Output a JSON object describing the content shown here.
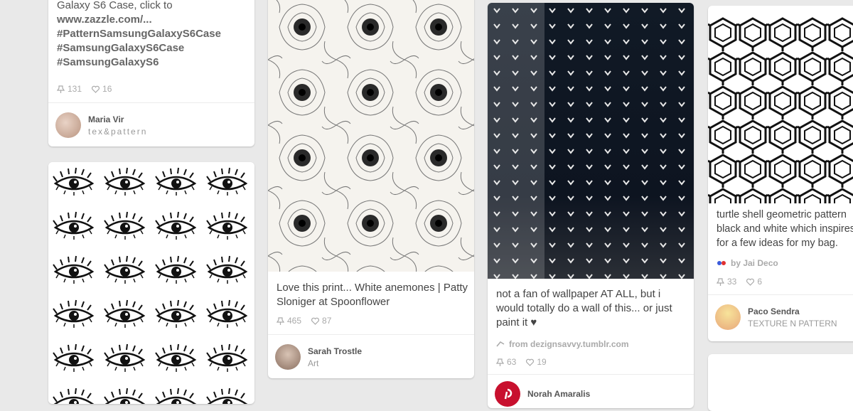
{
  "pins": [
    {
      "desc_lines": [
        "Galaxy S6 Case, click to",
        "www.zazzle.com/...",
        "#PatternSamsungGalaxyS6Case",
        "#SamsungGalaxyS6Case",
        "#SamsungGalaxyS6"
      ],
      "repins": "131",
      "likes": "16",
      "user": "Maria Vir",
      "board": "tex&pattern",
      "image_subject": "eyes-pattern"
    },
    {
      "desc": "Love this print... White anemones | Patty Sloniger at Spoonflower",
      "repins": "465",
      "likes": "87",
      "user": "Sarah Trostle",
      "board": "Art",
      "image_subject": "anemone-pattern"
    },
    {
      "desc": "not a fan of wallpaper AT ALL, but i would totally do a wall of this... or just paint it ♥",
      "source": "from dezignsavvy.tumblr.com",
      "repins": "63",
      "likes": "19",
      "user": "Norah Amaralis",
      "image_subject": "heart-pattern-wall"
    },
    {
      "desc": "turtle shell geometric pattern black and white which inspires for a few ideas for my bag.",
      "source": "by Jai Deco",
      "repins": "33",
      "likes": "6",
      "user": "Paco Sendra",
      "board": "TEXTURE N PATTERN",
      "image_subject": "hexagon-pattern"
    }
  ],
  "colors": {
    "background": "#e9e9e9",
    "card": "#ffffff",
    "heart": "#f0f0f0"
  },
  "icons": {
    "repin": "pin-icon",
    "like": "heart-icon",
    "source": "globe-icon"
  }
}
